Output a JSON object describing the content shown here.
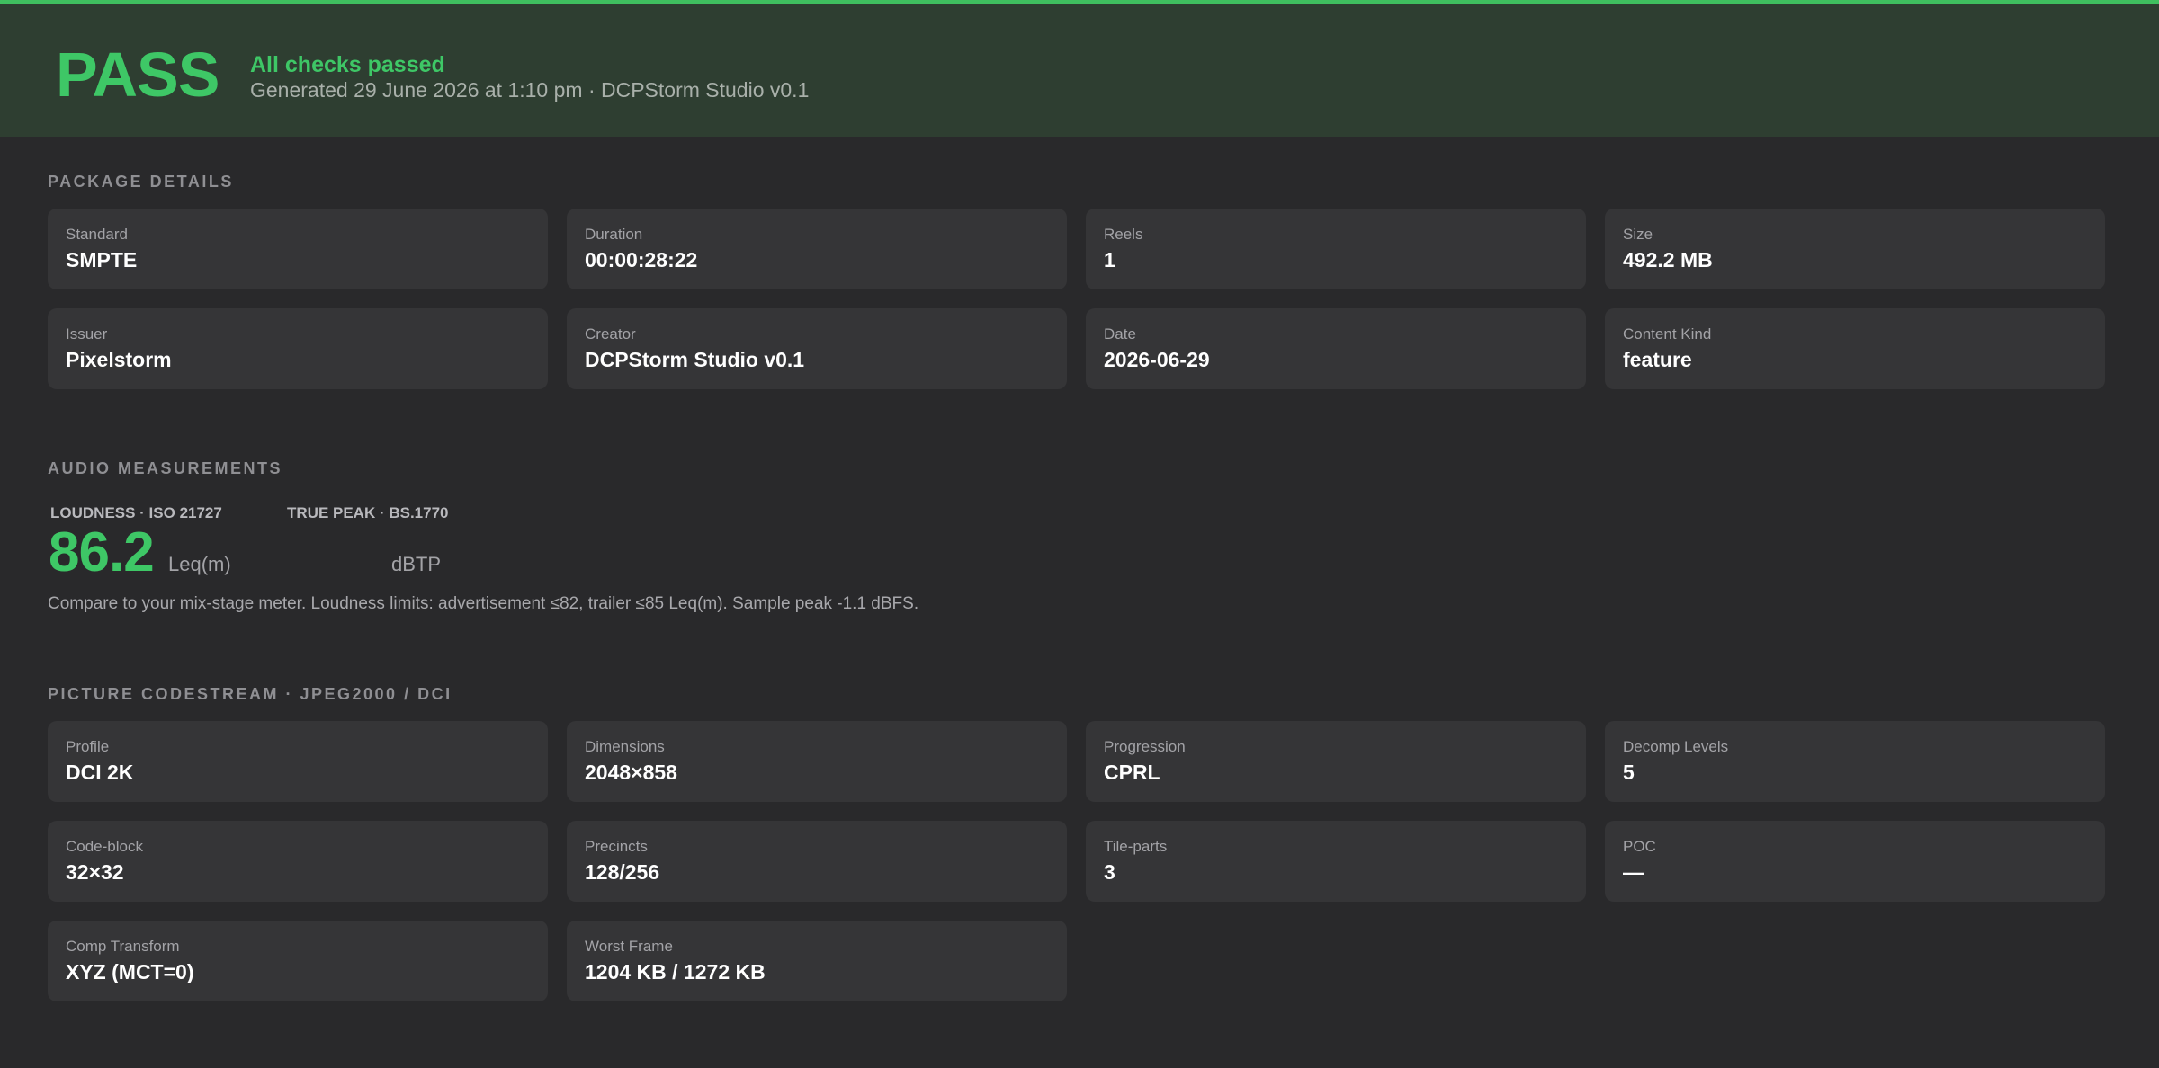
{
  "banner": {
    "status": "PASS",
    "title": "All checks passed",
    "subtitle": "Generated 29 June 2026 at 1:10 pm · DCPStorm Studio v0.1",
    "accent_color": "#3ec766",
    "background_color": "#2e3e31"
  },
  "package": {
    "section_title": "PACKAGE DETAILS",
    "items": [
      {
        "label": "Standard",
        "value": "SMPTE"
      },
      {
        "label": "Duration",
        "value": "00:00:28:22"
      },
      {
        "label": "Reels",
        "value": "1"
      },
      {
        "label": "Size",
        "value": "492.2 MB"
      },
      {
        "label": "Issuer",
        "value": "Pixelstorm"
      },
      {
        "label": "Creator",
        "value": "DCPStorm Studio v0.1"
      },
      {
        "label": "Date",
        "value": "2026-06-29"
      },
      {
        "label": "Content Kind",
        "value": "feature"
      }
    ]
  },
  "audio": {
    "section_title": "AUDIO MEASUREMENTS",
    "loudness_label": "LOUDNESS · ISO 21727",
    "loudness_value": "86.2",
    "loudness_unit": "Leq(m)",
    "peak_label": "TRUE PEAK · BS.1770",
    "peak_value": "",
    "peak_unit": "dBTP",
    "note": "Compare to your mix-stage meter. Loudness limits: advertisement ≤82, trailer ≤85 Leq(m). Sample peak -1.1 dBFS."
  },
  "picture": {
    "section_title": "PICTURE CODESTREAM · JPEG2000 / DCI",
    "items": [
      {
        "label": "Profile",
        "value": "DCI 2K"
      },
      {
        "label": "Dimensions",
        "value": "2048×858"
      },
      {
        "label": "Progression",
        "value": "CPRL"
      },
      {
        "label": "Decomp Levels",
        "value": "5"
      },
      {
        "label": "Code-block",
        "value": "32×32"
      },
      {
        "label": "Precincts",
        "value": "128/256"
      },
      {
        "label": "Tile-parts",
        "value": "3"
      },
      {
        "label": "POC",
        "value": "—"
      },
      {
        "label": "Comp Transform",
        "value": "XYZ (MCT=0)"
      },
      {
        "label": "Worst Frame",
        "value": "1204 KB / 1272 KB"
      }
    ]
  }
}
